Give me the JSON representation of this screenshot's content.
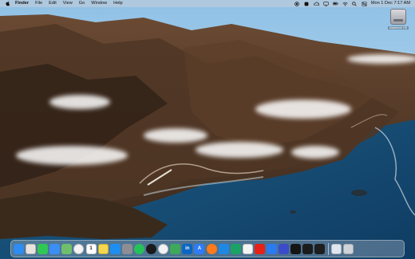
{
  "menubar": {
    "items": [
      "Finder",
      "File",
      "Edit",
      "View",
      "Go",
      "Window",
      "Help"
    ],
    "clock": "Mon 1 Dec  7:17 AM"
  },
  "desktop": {
    "drive_label": "Macintosh HD"
  },
  "dock": {
    "apps": [
      {
        "name": "finder",
        "color": "#2f8cf0"
      },
      {
        "name": "launchpad",
        "color": "#e9e3df"
      },
      {
        "name": "messages",
        "color": "#31c754"
      },
      {
        "name": "mail",
        "color": "#3b8ef3"
      },
      {
        "name": "maps",
        "color": "#6fbe6d"
      },
      {
        "name": "photos",
        "color": "#f4f2f2"
      },
      {
        "name": "calendar",
        "color": "#ffffff",
        "text": "1"
      },
      {
        "name": "notes",
        "color": "#f5d74e"
      },
      {
        "name": "app-store",
        "color": "#1f8ef1"
      },
      {
        "name": "system-settings",
        "color": "#8d8d93"
      },
      {
        "name": "whatsapp",
        "color": "#27c15a"
      },
      {
        "name": "github",
        "color": "#1b1b1b"
      },
      {
        "name": "chrome",
        "color": "#f2f2f2"
      },
      {
        "name": "android-studio",
        "color": "#3ea95b"
      },
      {
        "name": "linkedin",
        "color": "#0a66c2",
        "text": "in"
      },
      {
        "name": "translate",
        "color": "#2e7cf6",
        "text": "A"
      },
      {
        "name": "firefox",
        "color": "#ff7a1a"
      },
      {
        "name": "vscode",
        "color": "#1e88e5"
      },
      {
        "name": "zap",
        "color": "#1aa364"
      },
      {
        "name": "slack",
        "color": "#f4f4f4"
      },
      {
        "name": "youtube",
        "color": "#e62117"
      },
      {
        "name": "xcode",
        "color": "#2a7af0"
      },
      {
        "name": "claude",
        "color": "#3a4cc9"
      },
      {
        "name": "capcut",
        "color": "#151515"
      },
      {
        "name": "terminal",
        "color": "#1c1c1c"
      },
      {
        "name": "figma",
        "color": "#1e1e1e"
      },
      {
        "name": "preview",
        "color": "#dfe6ef"
      },
      {
        "name": "trash",
        "color": "#cfd3d8"
      }
    ]
  }
}
